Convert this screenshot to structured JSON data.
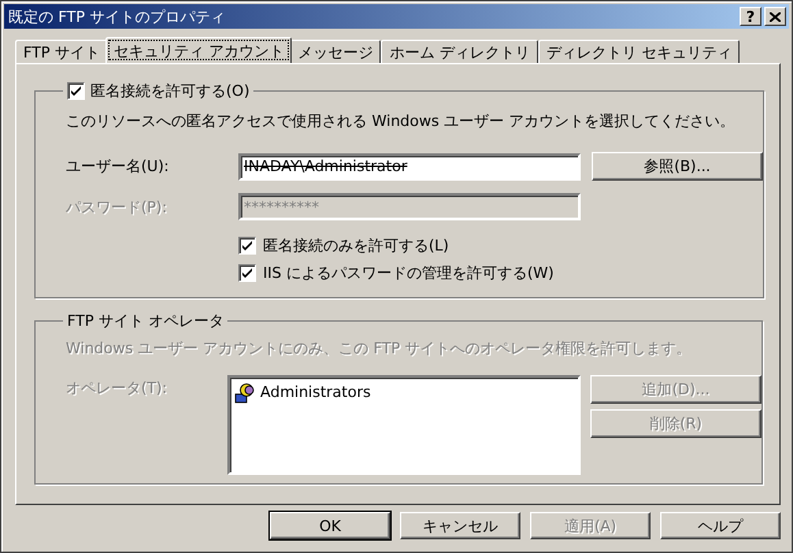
{
  "window": {
    "title": "既定の FTP サイトのプロパティ",
    "help_button": "?"
  },
  "tabs": [
    {
      "label": "FTP サイト",
      "selected": false
    },
    {
      "label": "セキュリティ アカウント",
      "selected": true
    },
    {
      "label": "メッセージ",
      "selected": false
    },
    {
      "label": "ホーム ディレクトリ",
      "selected": false
    },
    {
      "label": "ディレクトリ セキュリティ",
      "selected": false
    }
  ],
  "anonymous": {
    "checkbox": {
      "label": "匿名接続を許可する(O)",
      "checked": true
    },
    "description": "このリソースへの匿名アクセスで使用される Windows ユーザー アカウントを選択してください。",
    "username": {
      "label": "ユーザー名(U):",
      "value": "INADAY\\Administrator",
      "disabled": false
    },
    "password": {
      "label": "パスワード(P):",
      "value": "**********",
      "disabled": true
    },
    "browse_button": {
      "label": "参照(B)...",
      "disabled": false
    },
    "options": [
      {
        "label": "匿名接続のみを許可する(L)",
        "checked": true
      },
      {
        "label": "IIS によるパスワードの管理を許可する(W)",
        "checked": true
      }
    ]
  },
  "operators": {
    "title": "FTP サイト オペレータ",
    "disabled": true,
    "description": "Windows ユーザー アカウントにのみ、この FTP サイトへのオペレータ権限を許可します。",
    "list_label": "オペレータ(T):",
    "list_items": [
      {
        "label": "Administrators"
      }
    ],
    "buttons": [
      {
        "label": "追加(D)...",
        "disabled": true
      },
      {
        "label": "削除(R)",
        "disabled": true
      }
    ]
  },
  "footer_buttons": [
    {
      "label": "OK",
      "disabled": false,
      "default": true
    },
    {
      "label": "キャンセル",
      "disabled": false,
      "default": false
    },
    {
      "label": "適用(A)",
      "disabled": true,
      "default": false
    },
    {
      "label": "ヘルプ",
      "disabled": false,
      "default": false
    }
  ]
}
